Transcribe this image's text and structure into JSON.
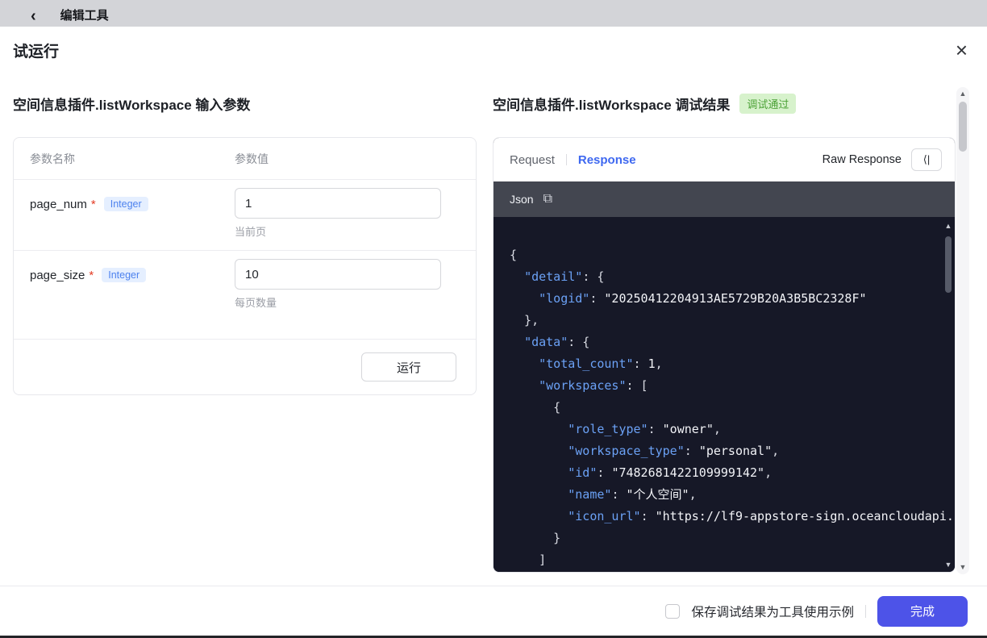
{
  "colors": {
    "accent_blue": "#4d53e8",
    "tab_active_blue": "#3e68f0",
    "json_key_blue": "#6ba1f5",
    "badge_green_bg": "#d7f2cc",
    "badge_green_text": "#4ba136",
    "type_badge_bg": "#e5efff",
    "type_badge_text": "#4d82ee",
    "code_bg": "#161827",
    "code_header_bg": "#434650"
  },
  "header": {
    "title": "编辑工具"
  },
  "modal": {
    "title": "试运行"
  },
  "input_panel": {
    "title": "空间信息插件.listWorkspace 输入参数",
    "headers": [
      "参数名称",
      "参数值"
    ],
    "rows": [
      {
        "name": "page_num",
        "required": "*",
        "type": "Integer",
        "value": "1",
        "hint": "当前页"
      },
      {
        "name": "page_size",
        "required": "*",
        "type": "Integer",
        "value": "10",
        "hint": "每页数量"
      }
    ],
    "run_button": "运行"
  },
  "result_panel": {
    "title": "空间信息插件.listWorkspace 调试结果",
    "status_badge": "调试通过",
    "tabs": [
      {
        "label": "Request",
        "active": false
      },
      {
        "label": "Response",
        "active": true
      }
    ],
    "raw_response_label": "Raw Response",
    "code_header": {
      "format_label": "Json"
    },
    "code_lines": [
      [
        [
          "p",
          "{"
        ]
      ],
      [
        [
          "p",
          "  "
        ],
        [
          "k",
          "\"detail\""
        ],
        [
          "p",
          ": {"
        ]
      ],
      [
        [
          "p",
          "    "
        ],
        [
          "k",
          "\"logid\""
        ],
        [
          "p",
          ": "
        ],
        [
          "s",
          "\"20250412204913AE5729B20A3B5BC2328F\""
        ]
      ],
      [
        [
          "p",
          "  },"
        ]
      ],
      [
        [
          "p",
          "  "
        ],
        [
          "k",
          "\"data\""
        ],
        [
          "p",
          ": {"
        ]
      ],
      [
        [
          "p",
          "    "
        ],
        [
          "k",
          "\"total_count\""
        ],
        [
          "p",
          ": "
        ],
        [
          "n",
          "1"
        ],
        [
          "p",
          ","
        ]
      ],
      [
        [
          "p",
          "    "
        ],
        [
          "k",
          "\"workspaces\""
        ],
        [
          "p",
          ": ["
        ]
      ],
      [
        [
          "p",
          "      {"
        ]
      ],
      [
        [
          "p",
          "        "
        ],
        [
          "k",
          "\"role_type\""
        ],
        [
          "p",
          ": "
        ],
        [
          "s",
          "\"owner\""
        ],
        [
          "p",
          ","
        ]
      ],
      [
        [
          "p",
          "        "
        ],
        [
          "k",
          "\"workspace_type\""
        ],
        [
          "p",
          ": "
        ],
        [
          "s",
          "\"personal\""
        ],
        [
          "p",
          ","
        ]
      ],
      [
        [
          "p",
          "        "
        ],
        [
          "k",
          "\"id\""
        ],
        [
          "p",
          ": "
        ],
        [
          "s",
          "\"7482681422109999142\""
        ],
        [
          "p",
          ","
        ]
      ],
      [
        [
          "p",
          "        "
        ],
        [
          "k",
          "\"name\""
        ],
        [
          "p",
          ": "
        ],
        [
          "s",
          "\"个人空间\""
        ],
        [
          "p",
          ","
        ]
      ],
      [
        [
          "p",
          "        "
        ],
        [
          "k",
          "\"icon_url\""
        ],
        [
          "p",
          ": "
        ],
        [
          "s",
          "\"https://lf9-appstore-sign.oceancloudapi."
        ]
      ],
      [
        [
          "p",
          "      }"
        ]
      ],
      [
        [
          "p",
          "    ]"
        ]
      ]
    ]
  },
  "footer": {
    "checkbox_label": "保存调试结果为工具使用示例",
    "done_button": "完成"
  },
  "icons": {
    "back": "‹",
    "close": "×",
    "copy": "⧉",
    "collapse": "⟨|",
    "scroll_up": "▲",
    "scroll_down": "▼"
  }
}
